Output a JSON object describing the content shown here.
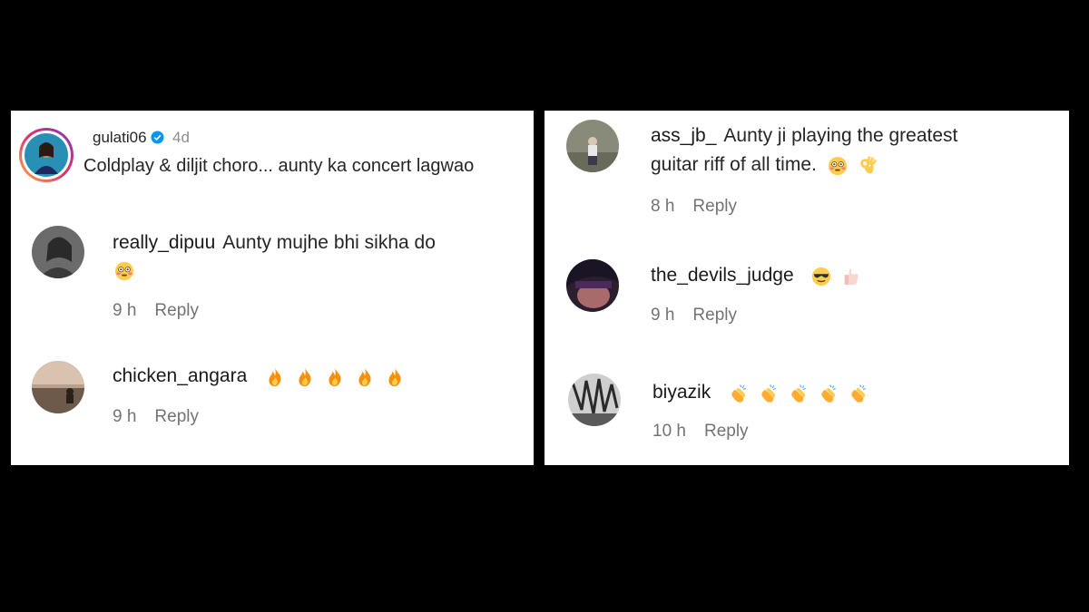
{
  "left": {
    "post": {
      "username": "gulati06",
      "time": "4d",
      "verified_icon": "verified-badge-icon",
      "text": "Coldplay & diljit choro... aunty ka concert lagwao"
    },
    "comments": [
      {
        "username": "really_dipuu",
        "text": "Aunty mujhe bhi sikha do",
        "emoji": [
          "flushed-face"
        ],
        "time": "9 h",
        "reply": "Reply"
      },
      {
        "username": "chicken_angara",
        "text": "",
        "emoji": [
          "fire",
          "fire",
          "fire",
          "fire",
          "fire"
        ],
        "time": "9 h",
        "reply": "Reply"
      }
    ]
  },
  "right": {
    "comments": [
      {
        "username": "ass_jb_",
        "text": "Aunty ji playing the greatest",
        "text2": "guitar riff of all time.",
        "emoji": [
          "flushed-face",
          "ok-hand"
        ],
        "time": "8 h",
        "reply": "Reply"
      },
      {
        "username": "the_devils_judge",
        "text": "",
        "emoji": [
          "sunglasses-face",
          "thumbs-up"
        ],
        "time": "9 h",
        "reply": "Reply"
      },
      {
        "username": "biyazik",
        "text": "",
        "emoji": [
          "clapping-hands",
          "clapping-hands",
          "clapping-hands",
          "clapping-hands",
          "clapping-hands"
        ],
        "time": "10 h",
        "reply": "Reply"
      }
    ]
  },
  "colors": {
    "background": "#000000",
    "panel": "#ffffff",
    "meta": "#737373",
    "verified": "#0095f6"
  }
}
